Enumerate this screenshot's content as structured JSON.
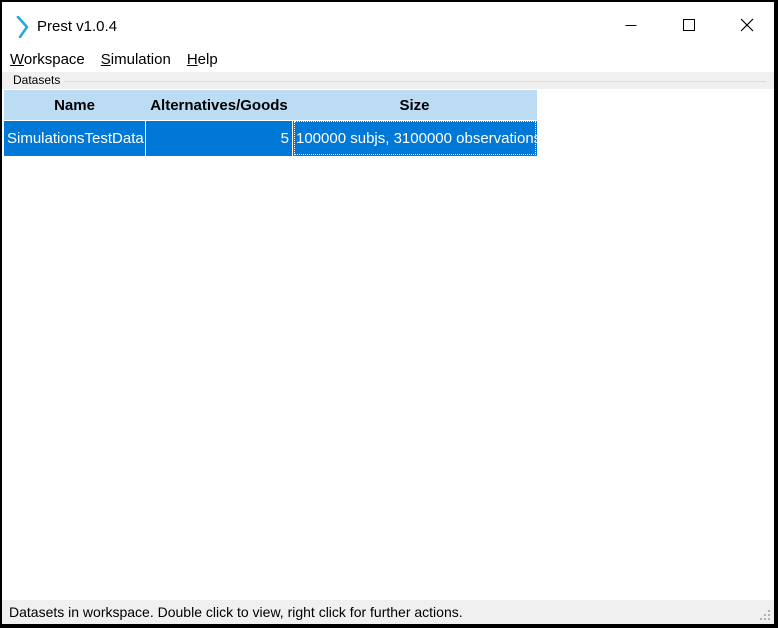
{
  "window": {
    "title": "Prest v1.0.4",
    "icon": "prest-logo-icon",
    "controls": [
      "minimize-icon",
      "maximize-icon",
      "close-icon"
    ]
  },
  "menu": {
    "workspace": {
      "accel": "W",
      "rest": "orkspace"
    },
    "simulation": {
      "accel": "S",
      "rest": "imulation"
    },
    "help": {
      "accel": "H",
      "rest": "elp"
    }
  },
  "datasets": {
    "group_label": "Datasets",
    "columns": [
      "Name",
      "Alternatives/Goods",
      "Size"
    ],
    "rows": [
      {
        "name": "SimulationsTestData",
        "alternatives": "5",
        "size": "100000 subjs, 3100000 observations",
        "selected": true
      }
    ]
  },
  "status": {
    "text": "Datasets in workspace. Double click to view, right click for further actions."
  },
  "colors": {
    "header_bg": "#bcdcf4",
    "selection_bg": "#0078d7",
    "status_bg": "#f0f0f0",
    "icon_accent": "#29a8e0"
  }
}
